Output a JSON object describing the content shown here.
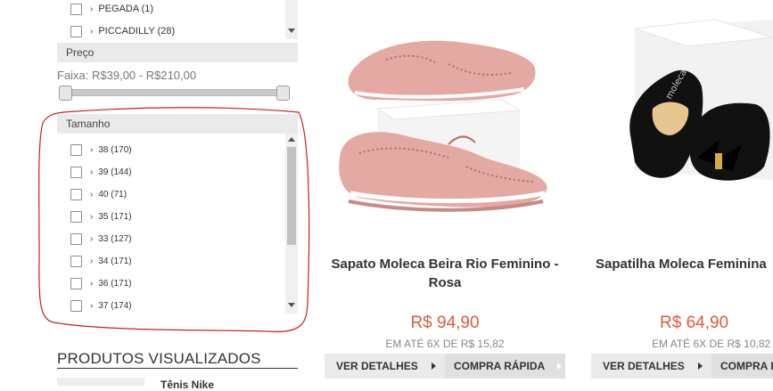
{
  "brand_filter": {
    "items": [
      {
        "label": "PEGADA (1)"
      },
      {
        "label": "PICCADILLY (28)"
      }
    ]
  },
  "price_filter": {
    "header": "Preço",
    "range_label": "Faixa: R$39,00 - R$210,00",
    "min_fraction": 0.0,
    "max_fraction": 1.0
  },
  "size_filter": {
    "header": "Tamanho",
    "items": [
      {
        "label": "38 (170)"
      },
      {
        "label": "39 (144)"
      },
      {
        "label": "40 (71)"
      },
      {
        "label": "35 (171)"
      },
      {
        "label": "33 (127)"
      },
      {
        "label": "34 (171)"
      },
      {
        "label": "36 (171)"
      },
      {
        "label": "37 (174)"
      }
    ]
  },
  "recent": {
    "title": "PRODUTOS VISUALIZADOS",
    "first_item_name": "Tênis Nike"
  },
  "products": [
    {
      "name_line1": "Sapato Moleca Beira Rio Feminino -",
      "name_line2": "Rosa",
      "price": "R$ 94,90",
      "installments": "EM ATÉ 6X DE R$ 15,82",
      "details_label": "VER DETALHES",
      "buy_label": "COMPRA RÁPIDA"
    },
    {
      "name_line1": "Sapatilha Moleca Feminina",
      "name_line2": "",
      "price": "R$ 64,90",
      "installments": "EM ATÉ 6X DE R$ 10,82",
      "details_label": "VER DETALHES",
      "buy_label": "COMPRA R"
    }
  ],
  "colors": {
    "price": "#e05a3a",
    "annotation": "#cc1f1f",
    "shoe_pink": "#e4a9a3"
  }
}
